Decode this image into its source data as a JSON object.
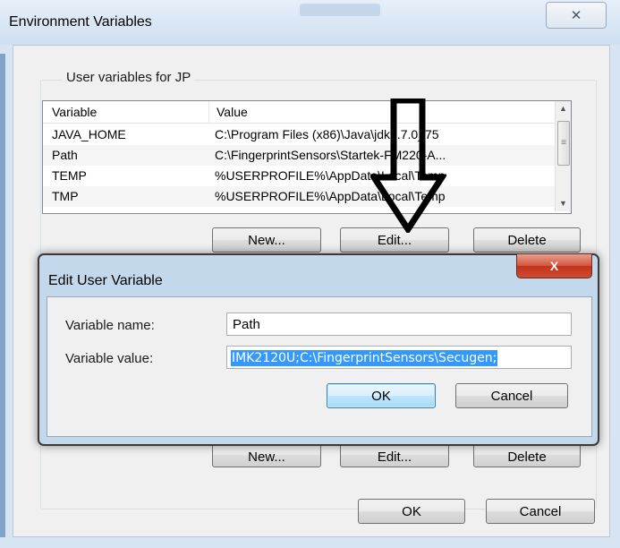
{
  "outer_window": {
    "title": "Environment Variables",
    "close_glyph": "✕",
    "group_label": "User variables for JP",
    "columns": [
      "Variable",
      "Value"
    ],
    "rows": [
      {
        "variable": "JAVA_HOME",
        "value": "C:\\Program Files (x86)\\Java\\jdk1.7.0_75"
      },
      {
        "variable": "Path",
        "value": "C:\\FingerprintSensors\\Startek-FM220-A..."
      },
      {
        "variable": "TEMP",
        "value": "%USERPROFILE%\\AppData\\Local\\Temp"
      },
      {
        "variable": "TMP",
        "value": "%USERPROFILE%\\AppData\\Local\\Temp"
      }
    ],
    "buttons": {
      "new": "New...",
      "edit": "Edit...",
      "delete": "Delete"
    },
    "hidden_buttons": {
      "new": "New...",
      "edit": "Edit...",
      "delete": "Delete"
    },
    "footer_buttons": {
      "ok": "OK",
      "cancel": "Cancel"
    }
  },
  "dialog": {
    "title": "Edit User Variable",
    "close_glyph": "X",
    "name_label": "Variable name:",
    "name_value": "Path",
    "value_label": "Variable value:",
    "value_value": "IMK2120U;C:\\FingerprintSensors\\Secugen;",
    "ok": "OK",
    "cancel": "Cancel"
  },
  "annotation": {
    "icon": "down-arrow-icon"
  },
  "colors": {
    "selection": "#3399ff",
    "dialog_close": "#c2331e",
    "frame": "#c4d8ec"
  }
}
